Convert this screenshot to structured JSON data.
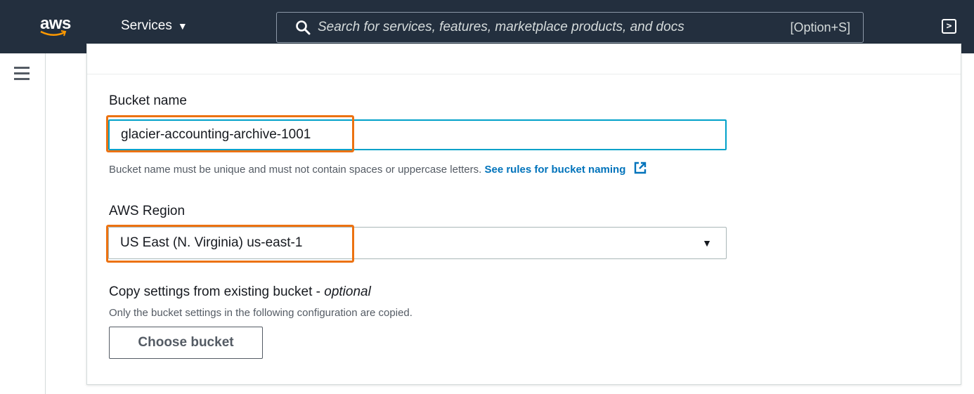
{
  "nav": {
    "logo_text": "aws",
    "services_label": "Services",
    "services_caret": "▼",
    "search_placeholder": "Search for services, features, marketplace products, and docs",
    "search_shortcut": "[Option+S]",
    "search_icon": "search-icon",
    "cloudshell_icon": "cloudshell-icon"
  },
  "form": {
    "bucket_name_label": "Bucket name",
    "bucket_name_value": "glacier-accounting-archive-1001",
    "bucket_name_help": "Bucket name must be unique and must not contain spaces or uppercase letters.",
    "bucket_name_link": "See rules for bucket naming",
    "region_label": "AWS Region",
    "region_value": "US East (N. Virginia) us-east-1",
    "copy_label": "Copy settings from existing bucket - ",
    "copy_label_optional": "optional",
    "copy_desc": "Only the bucket settings in the following configuration are copied.",
    "choose_bucket_button": "Choose bucket"
  },
  "colors": {
    "nav_bg": "#232f3e",
    "focus_border": "#00a1c9",
    "highlight": "#ec7211",
    "link": "#0073bb"
  }
}
